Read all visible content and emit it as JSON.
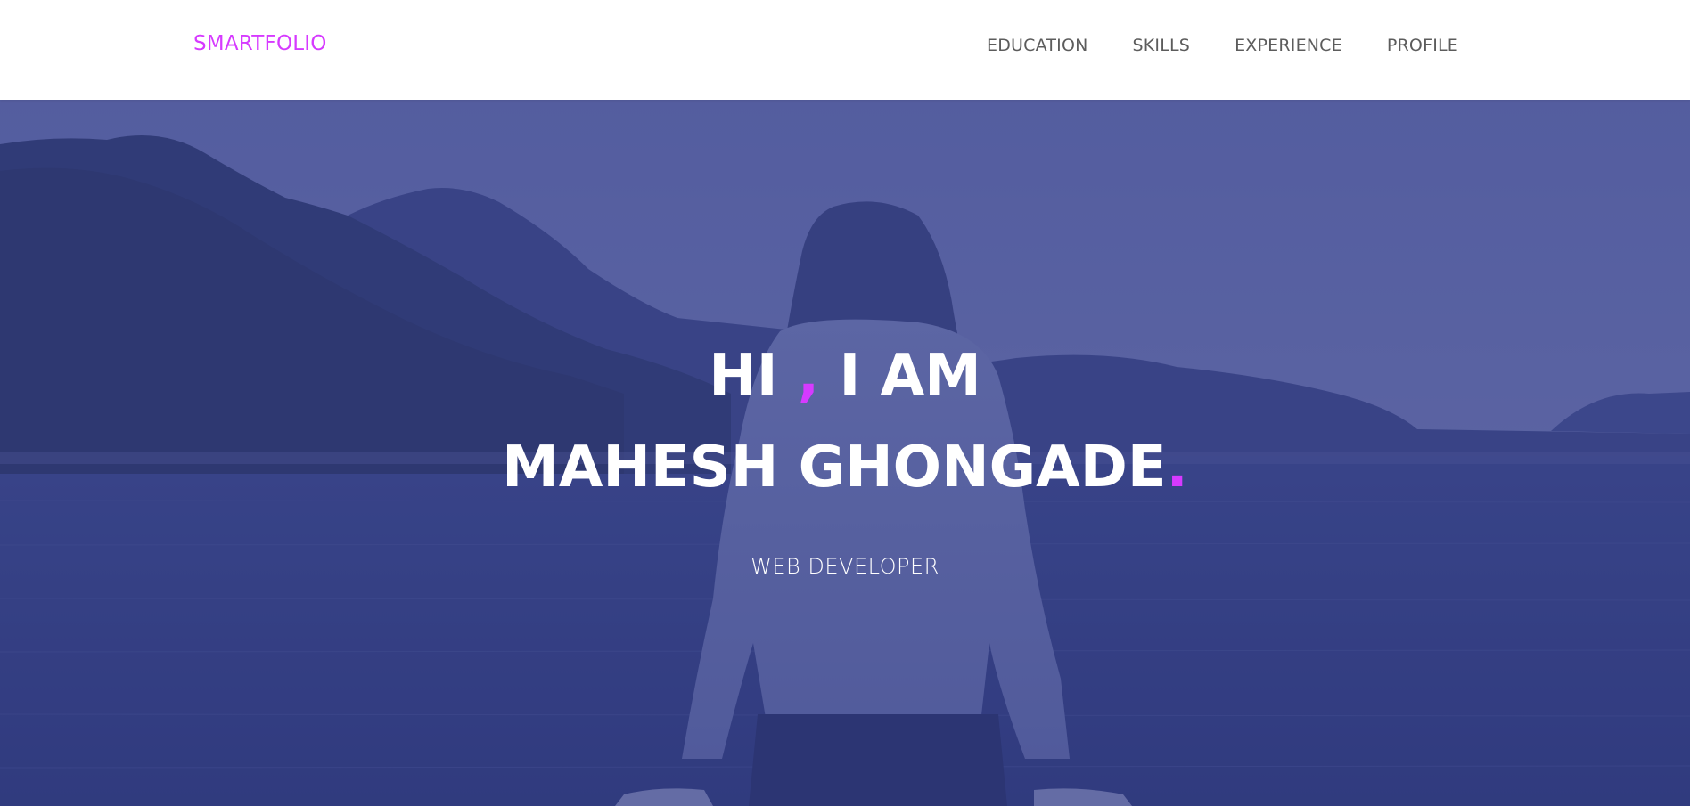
{
  "navbar": {
    "brand": "SMARTFOLIO",
    "links": [
      {
        "label": "EDUCATION"
      },
      {
        "label": "SKILLS"
      },
      {
        "label": "EXPERIENCE"
      },
      {
        "label": "PROFILE"
      }
    ]
  },
  "hero": {
    "greeting_before": "HI ",
    "greeting_comma": ",",
    "greeting_after": " I AM",
    "name": "MAHESH GHONGADE",
    "name_dot": ".",
    "role": "WEB DEVELOPER"
  },
  "colors": {
    "accent": "#d63aff",
    "overlay": "#343a8c",
    "nav_text": "#5c5c5c"
  }
}
